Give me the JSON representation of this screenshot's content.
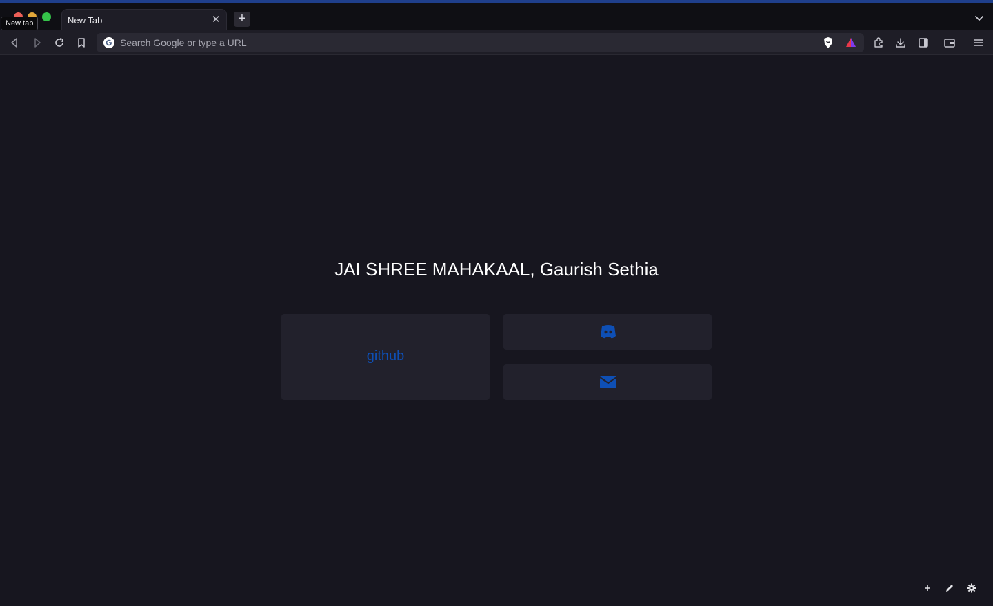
{
  "browser": {
    "tab_title": "New Tab",
    "tooltip": "New tab",
    "omnibox_placeholder": "Search Google or type a URL",
    "accent_color": "#1f3f8c"
  },
  "page": {
    "greeting": "JAI SHREE MAHAKAAL, Gaurish Sethia",
    "links": [
      {
        "label": "github",
        "icon": ""
      },
      {
        "label": "",
        "icon": "discord-icon"
      },
      {
        "label": "",
        "icon": "envelope-icon"
      }
    ],
    "link_color": "#0e4fb5"
  }
}
